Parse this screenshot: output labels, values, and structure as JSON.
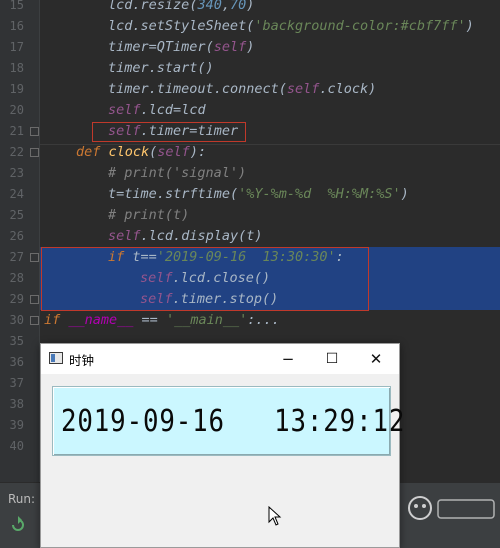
{
  "editor": {
    "lines": [
      {
        "no": "15",
        "tokens": [
          {
            "t": "lcd",
            "c": "c-meth"
          },
          {
            "t": ".",
            "c": "c-default"
          },
          {
            "t": "resize",
            "c": "c-meth"
          },
          {
            "t": "(",
            "c": "c-default"
          },
          {
            "t": "340",
            "c": "c-num"
          },
          {
            "t": ",",
            "c": "c-default"
          },
          {
            "t": "70",
            "c": "c-num"
          },
          {
            "t": ")",
            "c": "c-default"
          }
        ]
      },
      {
        "no": "16",
        "tokens": [
          {
            "t": "lcd",
            "c": "c-meth"
          },
          {
            "t": ".",
            "c": "c-default"
          },
          {
            "t": "setStyleSheet",
            "c": "c-meth"
          },
          {
            "t": "(",
            "c": "c-default"
          },
          {
            "t": "'background-color:#cbf7ff'",
            "c": "c-str"
          },
          {
            "t": ")",
            "c": "c-default"
          }
        ]
      },
      {
        "no": "17",
        "tokens": [
          {
            "t": "timer",
            "c": "c-meth"
          },
          {
            "t": "=",
            "c": "c-default"
          },
          {
            "t": "QTimer",
            "c": "c-meth"
          },
          {
            "t": "(",
            "c": "c-default"
          },
          {
            "t": "self",
            "c": "c-self"
          },
          {
            "t": ")",
            "c": "c-default"
          }
        ]
      },
      {
        "no": "18",
        "tokens": [
          {
            "t": "timer",
            "c": "c-meth"
          },
          {
            "t": ".",
            "c": "c-default"
          },
          {
            "t": "start",
            "c": "c-meth"
          },
          {
            "t": "()",
            "c": "c-default"
          }
        ]
      },
      {
        "no": "19",
        "tokens": [
          {
            "t": "timer",
            "c": "c-meth"
          },
          {
            "t": ".",
            "c": "c-default"
          },
          {
            "t": "timeout",
            "c": "c-meth"
          },
          {
            "t": ".",
            "c": "c-default"
          },
          {
            "t": "connect",
            "c": "c-meth"
          },
          {
            "t": "(",
            "c": "c-default"
          },
          {
            "t": "self",
            "c": "c-self"
          },
          {
            "t": ".",
            "c": "c-default"
          },
          {
            "t": "clock",
            "c": "c-meth"
          },
          {
            "t": ")",
            "c": "c-default"
          }
        ]
      },
      {
        "no": "20",
        "tokens": [
          {
            "t": "self",
            "c": "c-self"
          },
          {
            "t": ".",
            "c": "c-default"
          },
          {
            "t": "lcd",
            "c": "c-meth"
          },
          {
            "t": "=",
            "c": "c-default"
          },
          {
            "t": "lcd",
            "c": "c-meth"
          }
        ]
      },
      {
        "no": "21",
        "tokens": [
          {
            "t": "self",
            "c": "c-self"
          },
          {
            "t": ".",
            "c": "c-default"
          },
          {
            "t": "timer",
            "c": "c-meth"
          },
          {
            "t": "=",
            "c": "c-default"
          },
          {
            "t": "timer",
            "c": "c-meth"
          }
        ]
      },
      {
        "no": "22",
        "tokens": [
          {
            "t": "def ",
            "c": "c-kw"
          },
          {
            "t": "clock",
            "c": "c-fn"
          },
          {
            "t": "(",
            "c": "c-default"
          },
          {
            "t": "self",
            "c": "c-self"
          },
          {
            "t": "):",
            "c": "c-default"
          }
        ]
      },
      {
        "no": "23",
        "tokens": [
          {
            "t": "# print('signal')",
            "c": "c-com"
          }
        ]
      },
      {
        "no": "24",
        "tokens": [
          {
            "t": "t",
            "c": "c-meth"
          },
          {
            "t": "=",
            "c": "c-default"
          },
          {
            "t": "time",
            "c": "c-meth"
          },
          {
            "t": ".",
            "c": "c-default"
          },
          {
            "t": "strftime",
            "c": "c-meth"
          },
          {
            "t": "(",
            "c": "c-default"
          },
          {
            "t": "'%Y-%m-%d  %H:%M:%S'",
            "c": "c-str"
          },
          {
            "t": ")",
            "c": "c-default"
          }
        ]
      },
      {
        "no": "25",
        "tokens": [
          {
            "t": "# print(t)",
            "c": "c-com"
          }
        ]
      },
      {
        "no": "26",
        "tokens": [
          {
            "t": "self",
            "c": "c-self"
          },
          {
            "t": ".",
            "c": "c-default"
          },
          {
            "t": "lcd",
            "c": "c-meth"
          },
          {
            "t": ".",
            "c": "c-default"
          },
          {
            "t": "display",
            "c": "c-meth"
          },
          {
            "t": "(",
            "c": "c-default"
          },
          {
            "t": "t",
            "c": "c-meth"
          },
          {
            "t": ")",
            "c": "c-default"
          }
        ]
      },
      {
        "no": "27",
        "tokens": [
          {
            "t": "if ",
            "c": "c-kw"
          },
          {
            "t": "t",
            "c": "c-meth"
          },
          {
            "t": "==",
            "c": "c-default"
          },
          {
            "t": "'2019-09-16  13:30:30'",
            "c": "c-str"
          },
          {
            "t": ":",
            "c": "c-default"
          }
        ]
      },
      {
        "no": "28",
        "tokens": [
          {
            "t": "self",
            "c": "c-self"
          },
          {
            "t": ".",
            "c": "c-default"
          },
          {
            "t": "lcd",
            "c": "c-meth"
          },
          {
            "t": ".",
            "c": "c-default"
          },
          {
            "t": "close",
            "c": "c-meth"
          },
          {
            "t": "()",
            "c": "c-default"
          }
        ]
      },
      {
        "no": "29",
        "tokens": [
          {
            "t": "self",
            "c": "c-self"
          },
          {
            "t": ".",
            "c": "c-default"
          },
          {
            "t": "timer",
            "c": "c-meth"
          },
          {
            "t": ".",
            "c": "c-default"
          },
          {
            "t": "stop",
            "c": "c-meth"
          },
          {
            "t": "()",
            "c": "c-default"
          }
        ]
      },
      {
        "no": "30",
        "tokens": [
          {
            "t": "if ",
            "c": "c-kw"
          },
          {
            "t": "__name__",
            "c": "c-dunder"
          },
          {
            "t": " == ",
            "c": "c-default"
          },
          {
            "t": "'__main__'",
            "c": "c-str"
          },
          {
            "t": ":...",
            "c": "c-default"
          }
        ]
      },
      {
        "no": "35",
        "tokens": []
      },
      {
        "no": "36",
        "tokens": []
      },
      {
        "no": "37",
        "tokens": []
      },
      {
        "no": "38",
        "tokens": []
      },
      {
        "no": "39",
        "tokens": []
      },
      {
        "no": "40",
        "tokens": []
      }
    ]
  },
  "run_bar": {
    "label": "Run:"
  },
  "qt_window": {
    "title": "时钟",
    "minimize": "−",
    "maximize": "☐",
    "close": "✕",
    "lcd_text": "2019-09-16   13:29:12",
    "lcd_bg": "#cbf7ff"
  },
  "colors": {
    "editor_bg": "#2b2b2b",
    "selection": "#214283",
    "highlight_box": "#c0392b"
  }
}
